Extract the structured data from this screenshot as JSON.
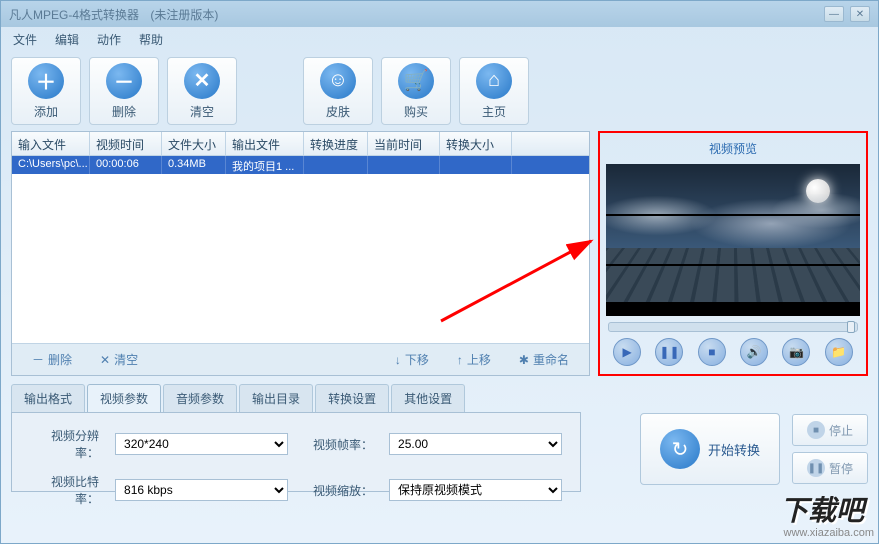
{
  "titlebar": {
    "title": "凡人MPEG-4格式转换器",
    "status": "(未注册版本)"
  },
  "menu": {
    "file": "文件",
    "edit": "编辑",
    "action": "动作",
    "help": "帮助"
  },
  "toolbar": {
    "add": "添加",
    "remove": "删除",
    "clear": "清空",
    "skin": "皮肤",
    "buy": "购买",
    "home": "主页"
  },
  "table": {
    "headers": [
      "输入文件",
      "视频时间",
      "文件大小",
      "输出文件",
      "转换进度",
      "当前时间",
      "转换大小"
    ],
    "rows": [
      {
        "input": "C:\\Users\\pc\\...",
        "time": "00:00:06",
        "size": "0.34MB",
        "output": "我的项目1 ...",
        "progress": "",
        "current": "",
        "convsize": ""
      }
    ],
    "footer": {
      "delete": "删除",
      "clear": "清空",
      "down": "下移",
      "up": "上移",
      "rename": "重命名"
    }
  },
  "preview": {
    "title": "视频预览"
  },
  "tabs": {
    "items": [
      "输出格式",
      "视频参数",
      "音频参数",
      "输出目录",
      "转换设置",
      "其他设置"
    ],
    "activeIndex": 1
  },
  "videoParams": {
    "resolutionLabel": "视频分辨率：",
    "resolution": "320*240",
    "bitrateLabel": "视频比特率：",
    "bitrate": "816 kbps",
    "fpsLabel": "视频帧率：",
    "fps": "25.00",
    "zoomLabel": "视频缩放：",
    "zoom": "保持原视频模式"
  },
  "actions": {
    "start": "开始转换",
    "stop": "停止",
    "pause": "暂停"
  },
  "watermark": {
    "url": "www.xiazaiba.com",
    "logo": "下载吧"
  },
  "icons": {
    "plus": "＋",
    "minus": "－",
    "x": "✕",
    "smile": "☺",
    "cart": "🛒",
    "home": "⌂",
    "play": "▶",
    "pause": "❚❚",
    "stopIcon": "■",
    "volume": "🔊",
    "camera": "📷",
    "folder": "📁",
    "refresh": "↻",
    "stopCircle": "■",
    "pauseCircle": "❚❚",
    "arrowDown": "↓",
    "arrowUp": "↑",
    "gear": "✱"
  }
}
